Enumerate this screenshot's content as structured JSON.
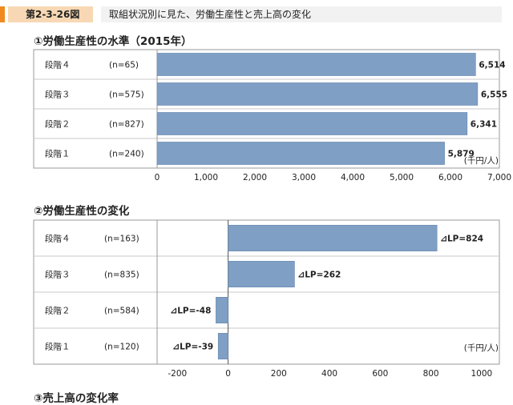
{
  "header": {
    "figure_number": "第2-3-26図",
    "figure_title": "取組状況別に見た、労働生産性と売上高の変化",
    "accent_color": "#f08a1e",
    "number_bg_color": "#f8d8b4"
  },
  "sections": [
    {
      "title": "①労働生産性の水準（2015年）"
    },
    {
      "title": "②労働生産性の変化"
    },
    {
      "title": "③売上高の変化率"
    }
  ],
  "chart_data": [
    {
      "type": "bar",
      "orientation": "horizontal",
      "title": "①労働生産性の水準（2015年）",
      "categories": [
        "段階４",
        "段階３",
        "段階２",
        "段階１"
      ],
      "sample_sizes": [
        "(n=65)",
        "(n=575)",
        "(n=827)",
        "(n=240)"
      ],
      "values": [
        6514,
        6555,
        6341,
        5879
      ],
      "data_labels": [
        "6,514",
        "6,555",
        "6,341",
        "5,879"
      ],
      "xlim": [
        0,
        7000
      ],
      "ticks": [
        0,
        1000,
        2000,
        3000,
        4000,
        5000,
        6000,
        7000
      ],
      "tick_labels": [
        "0",
        "1,000",
        "2,000",
        "3,000",
        "4,000",
        "5,000",
        "6,000",
        "7,000"
      ],
      "unit": "(千円/人)",
      "bar_color": "#7f9fc5"
    },
    {
      "type": "bar",
      "orientation": "horizontal",
      "title": "②労働生産性の変化",
      "categories": [
        "段階４",
        "段階３",
        "段階２",
        "段階１"
      ],
      "sample_sizes": [
        "(n=163)",
        "(n=835)",
        "(n=584)",
        "(n=120)"
      ],
      "values": [
        824,
        262,
        -48,
        -39
      ],
      "data_labels": [
        "⊿LP=824",
        "⊿LP=262",
        "⊿LP=-48",
        "⊿LP=-39"
      ],
      "xlim": [
        -280,
        1070
      ],
      "ticks": [
        -200,
        0,
        200,
        400,
        600,
        800,
        1000
      ],
      "tick_labels": [
        "-200",
        "0",
        "200",
        "400",
        "600",
        "800",
        "1000"
      ],
      "unit": "(千円/人)",
      "bar_color": "#7f9fc5"
    }
  ]
}
